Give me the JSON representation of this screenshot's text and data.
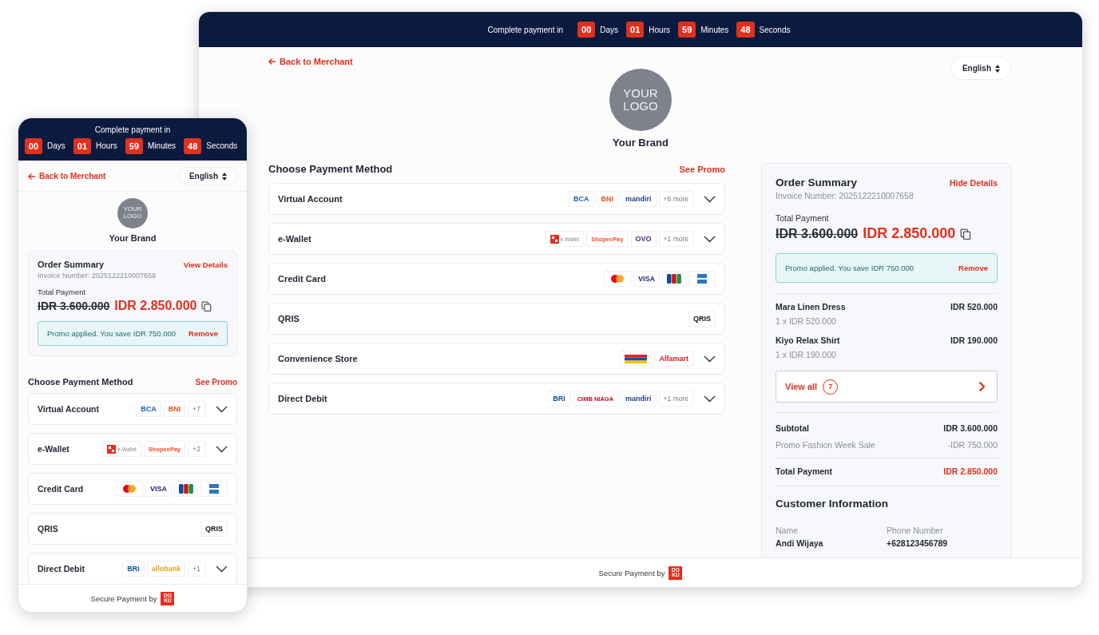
{
  "desktop": {
    "countdown": {
      "label": "Complete payment in",
      "units": [
        {
          "value": "00",
          "unit": "Days"
        },
        {
          "value": "01",
          "unit": "Hours"
        },
        {
          "value": "59",
          "unit": "Minutes"
        },
        {
          "value": "48",
          "unit": "Seconds"
        }
      ]
    },
    "back_link": "Back to Merchant",
    "language": "English",
    "logo_text": [
      "YOUR",
      "LOGO"
    ],
    "brand": "Your Brand",
    "payment": {
      "title": "Choose Payment Method",
      "promo_link": "See Promo",
      "methods": [
        {
          "name": "Virtual Account",
          "expandable": true,
          "logos": [
            {
              "kind": "text",
              "label": "BCA",
              "color": "#1a5bb5"
            },
            {
              "kind": "text",
              "label": "BNI",
              "color": "#e8501b"
            },
            {
              "kind": "text",
              "label": "mandiri",
              "color": "#1d3f8f"
            },
            {
              "kind": "more",
              "label": "+6 more"
            }
          ]
        },
        {
          "name": "e-Wallet",
          "expandable": true,
          "logos": [
            {
              "kind": "doku",
              "label": "e-Wallet"
            },
            {
              "kind": "text",
              "label": "ShopeePay",
              "color": "#ee4d2d"
            },
            {
              "kind": "text",
              "label": "OVO",
              "color": "#4c2a86"
            },
            {
              "kind": "more",
              "label": "+1 more"
            }
          ]
        },
        {
          "name": "Credit Card",
          "expandable": false,
          "logos": [
            {
              "kind": "mastercard"
            },
            {
              "kind": "text",
              "label": "VISA",
              "color": "#1a1f71"
            },
            {
              "kind": "jcb"
            },
            {
              "kind": "amex"
            }
          ]
        },
        {
          "name": "QRIS",
          "expandable": false,
          "logos": [
            {
              "kind": "text",
              "label": "QRIS",
              "color": "#111111"
            }
          ]
        },
        {
          "name": "Convenience Store",
          "expandable": true,
          "logos": [
            {
              "kind": "stripes"
            },
            {
              "kind": "text",
              "label": "Alfamart",
              "color": "#d7191f"
            }
          ]
        },
        {
          "name": "Direct Debit",
          "expandable": true,
          "logos": [
            {
              "kind": "text",
              "label": "BRI",
              "color": "#00529c"
            },
            {
              "kind": "text",
              "label": "CIMB NIAGA",
              "color": "#b5121b"
            },
            {
              "kind": "text",
              "label": "mandiri",
              "color": "#1d3f8f"
            },
            {
              "kind": "more",
              "label": "+1 more"
            }
          ]
        }
      ]
    },
    "summary": {
      "title": "Order Summary",
      "toggle": "Hide Details",
      "invoice": "Invoice Number: 2025122210007658",
      "total_label": "Total Payment",
      "original": "IDR 3.600.000",
      "total": "IDR 2.850.000",
      "promo": {
        "text": "Promo applied. You save IDR 750.000",
        "action": "Remove"
      },
      "items": [
        {
          "name": "Mara Linen Dress",
          "detail": "1 x IDR 520.000",
          "price": "IDR 520.000"
        },
        {
          "name": "Kiyo Relax Shirt",
          "detail": "1 x IDR 190.000",
          "price": "IDR 190.000"
        }
      ],
      "view_all": {
        "label": "View all",
        "count": "7"
      },
      "lines": [
        {
          "kind": "strong",
          "label": "Subtotal",
          "value": "IDR 3.600.000"
        },
        {
          "kind": "muted",
          "label": "Promo Fashion Week Sale",
          "value": "-IDR 750.000"
        },
        {
          "kind": "total",
          "label": "Total Payment",
          "value": "IDR 2.850.000"
        }
      ],
      "customer": {
        "title": "Customer Information",
        "fields": [
          {
            "label": "Name",
            "value": "Andi Wijaya"
          },
          {
            "label": "Phone Number",
            "value": "+628123456789"
          }
        ]
      }
    },
    "footer": {
      "text": "Secure Payment by",
      "mark": [
        "DO",
        "KU"
      ]
    }
  },
  "mobile": {
    "countdown": {
      "label": "Complete payment in",
      "units": [
        {
          "value": "00",
          "unit": "Days"
        },
        {
          "value": "01",
          "unit": "Hours"
        },
        {
          "value": "59",
          "unit": "Minutes"
        },
        {
          "value": "48",
          "unit": "Seconds"
        }
      ]
    },
    "back_link": "Back to Merchant",
    "language": "English",
    "logo_text": [
      "YOUR",
      "LOGO"
    ],
    "brand": "Your Brand",
    "summary": {
      "title": "Order Summary",
      "toggle": "View Details",
      "invoice": "Invoice Number: 2025122210007658",
      "total_label": "Total Payment",
      "original": "IDR 3.600.000",
      "total": "IDR 2.850.000",
      "promo": {
        "text": "Promo applied. You save IDR 750.000",
        "action": "Remove"
      }
    },
    "payment": {
      "title": "Choose Payment Method",
      "promo_link": "See Promo",
      "methods": [
        {
          "name": "Virtual Account",
          "expandable": true,
          "logos": [
            {
              "kind": "text",
              "label": "BCA",
              "color": "#1a5bb5"
            },
            {
              "kind": "text",
              "label": "BNI",
              "color": "#e8501b"
            },
            {
              "kind": "more",
              "label": "+7"
            }
          ]
        },
        {
          "name": "e-Wallet",
          "expandable": true,
          "logos": [
            {
              "kind": "doku",
              "label": "e-Wallet"
            },
            {
              "kind": "text",
              "label": "ShopeePay",
              "color": "#ee4d2d"
            },
            {
              "kind": "more",
              "label": "+2"
            }
          ]
        },
        {
          "name": "Credit Card",
          "expandable": false,
          "logos": [
            {
              "kind": "mastercard"
            },
            {
              "kind": "text",
              "label": "VISA",
              "color": "#1a1f71"
            },
            {
              "kind": "jcb"
            },
            {
              "kind": "amex"
            }
          ]
        },
        {
          "name": "QRIS",
          "expandable": false,
          "logos": [
            {
              "kind": "text",
              "label": "QRIS",
              "color": "#111111"
            }
          ]
        },
        {
          "name": "Direct Debit",
          "expandable": true,
          "logos": [
            {
              "kind": "text",
              "label": "BRI",
              "color": "#00529c"
            },
            {
              "kind": "text",
              "label": "allobank",
              "color": "#e0a21a"
            },
            {
              "kind": "more",
              "label": "+1"
            }
          ]
        }
      ]
    },
    "footer": {
      "text": "Secure Payment by",
      "mark": [
        "DO",
        "KU"
      ]
    }
  }
}
